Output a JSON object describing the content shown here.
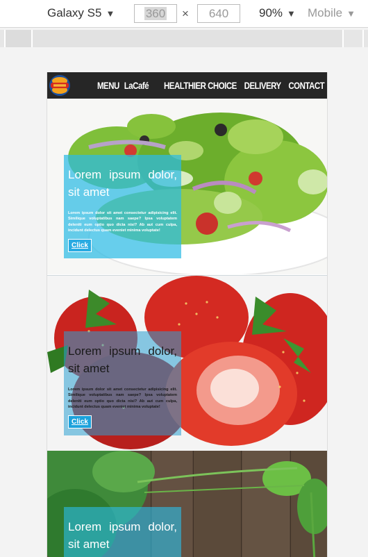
{
  "devtools": {
    "device": "Galaxy S5",
    "width": "360",
    "height": "640",
    "separator": "×",
    "zoom": "90%",
    "mode": "Mobile"
  },
  "nav": {
    "items": [
      "MENU",
      "LaCafé",
      "HEALTHIER CHOICE",
      "DELIVERY",
      "CONTACT"
    ]
  },
  "sections": [
    {
      "title": "Lorem ipsum dolor, sit amet",
      "body": "Lorem ipsum dolor sit amet consectetur adipisicing elit. Similique voluptatibus nam saepe? Ipsa voluptatem deleniti eum optio quo dicta nisi? Ab aut cum culpa, incidunt delectus quam eveniet minima voluptate!",
      "button": "Click",
      "image": "salad-bowl"
    },
    {
      "title": "Lorem ipsum dolor, sit amet",
      "body": "Lorem ipsum dolor sit amet consectetur adipisicing elit. Similique voluptatibus nam saepe? Ipsa voluptatem deleniti eum optio quo dicta nisi? Ab aut cum culpa, incidunt delectus quam eveniet minima voluptate!",
      "button": "Click",
      "image": "strawberries"
    },
    {
      "title": "Lorem ipsum dolor, sit amet",
      "image": "herbs-on-wood"
    }
  ]
}
